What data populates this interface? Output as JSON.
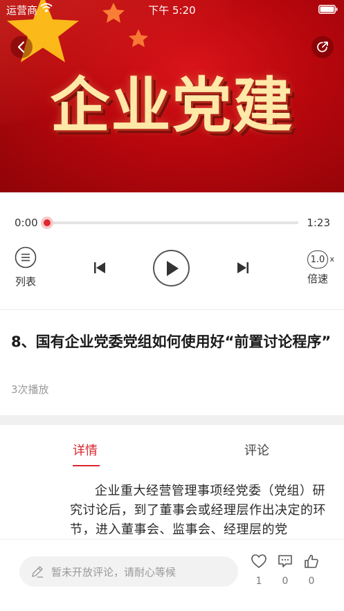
{
  "status_bar": {
    "carrier": "运营商",
    "time": "下午 5:20"
  },
  "banner": {
    "title": "企业党建"
  },
  "player": {
    "current_time": "0:00",
    "total_time": "1:23",
    "progress": 0,
    "list_label": "列表",
    "speed_value": "1.0",
    "speed_suffix": "x",
    "speed_label": "倍速"
  },
  "episode": {
    "title": "8、国有企业党委党组如何使用好“前置讨论程序”",
    "play_count": "3次播放"
  },
  "tabs": {
    "details": "详情",
    "comments": "评论"
  },
  "article": {
    "text": "企业重大经营管理事项经党委（党组）研究讨论后，到了董事会或经理层作出决定的环节，进入董事会、监事会、经理层的党"
  },
  "bottom_bar": {
    "comment_placeholder": "暂未开放评论，请耐心等候",
    "like_count": "1",
    "comment_count": "0",
    "thumb_count": "0"
  },
  "colors": {
    "accent": "#d9262c",
    "banner_red": "#b8070d",
    "banner_gold": "#ffe8a8"
  }
}
